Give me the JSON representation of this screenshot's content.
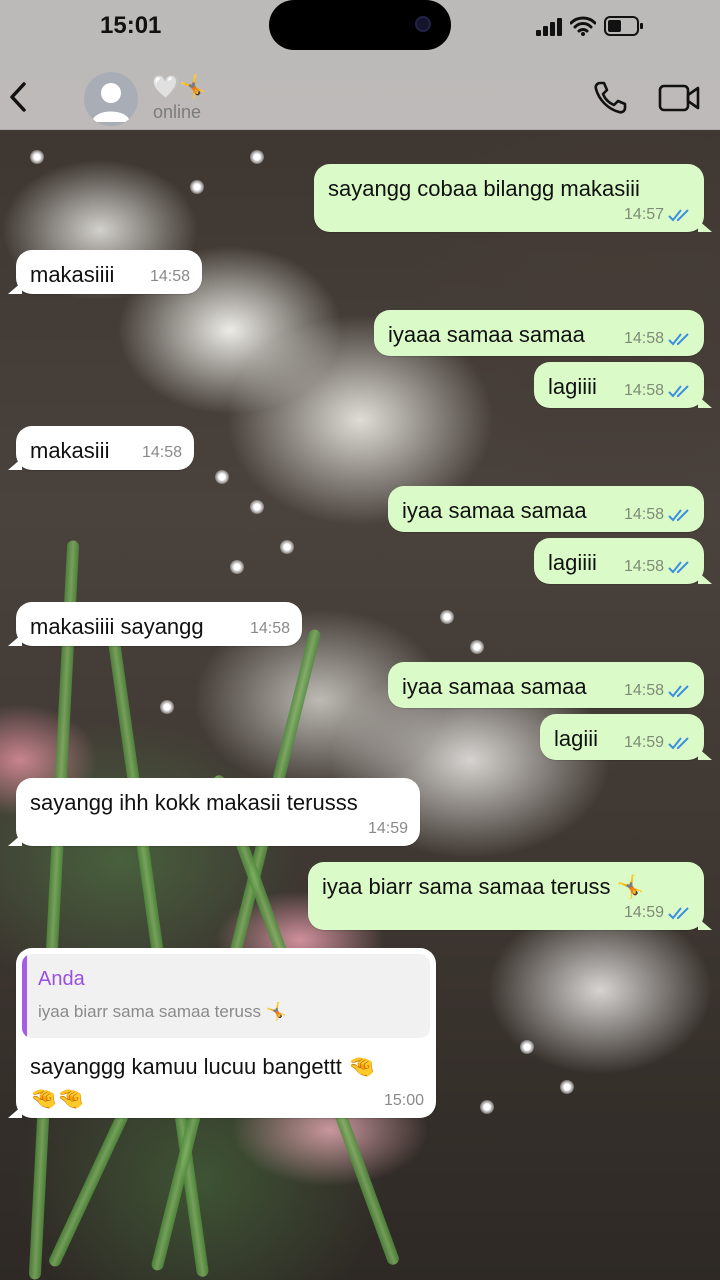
{
  "status_bar": {
    "time": "15:01"
  },
  "header": {
    "contact_name": "🤍🤸",
    "contact_status": "online"
  },
  "messages": [
    {
      "dir": "out",
      "text": "sayangg cobaa bilangg makasiii",
      "time": "14:57"
    },
    {
      "dir": "in",
      "text": "makasiiii",
      "time": "14:58"
    },
    {
      "dir": "out",
      "text": "iyaaa samaa samaa",
      "time": "14:58"
    },
    {
      "dir": "out",
      "text": "lagiiii",
      "time": "14:58"
    },
    {
      "dir": "in",
      "text": "makasiii",
      "time": "14:58"
    },
    {
      "dir": "out",
      "text": "iyaa samaa samaa",
      "time": "14:58"
    },
    {
      "dir": "out",
      "text": "lagiiii",
      "time": "14:58"
    },
    {
      "dir": "in",
      "text": "makasiiii sayangg",
      "time": "14:58"
    },
    {
      "dir": "out",
      "text": "iyaa samaa samaa",
      "time": "14:58"
    },
    {
      "dir": "out",
      "text": "lagiii",
      "time": "14:59"
    },
    {
      "dir": "in",
      "text": "sayangg ihh kokk makasii terusss",
      "time": "14:59"
    },
    {
      "dir": "out",
      "text": "iyaa biarr sama samaa teruss 🤸",
      "time": "14:59"
    },
    {
      "dir": "in",
      "quote_name": "Anda",
      "quote_text": "iyaa biarr sama samaa teruss 🤸",
      "text_line1": "sayanggg kamuu lucuu bangettt 🤏",
      "text_line2": "🤏🤏",
      "time": "15:00"
    }
  ],
  "colors": {
    "outgoing_bubble": "#dafbc8",
    "incoming_bubble": "#ffffff",
    "read_ticks": "#3b8fe0",
    "quote_accent": "#a45de6"
  }
}
